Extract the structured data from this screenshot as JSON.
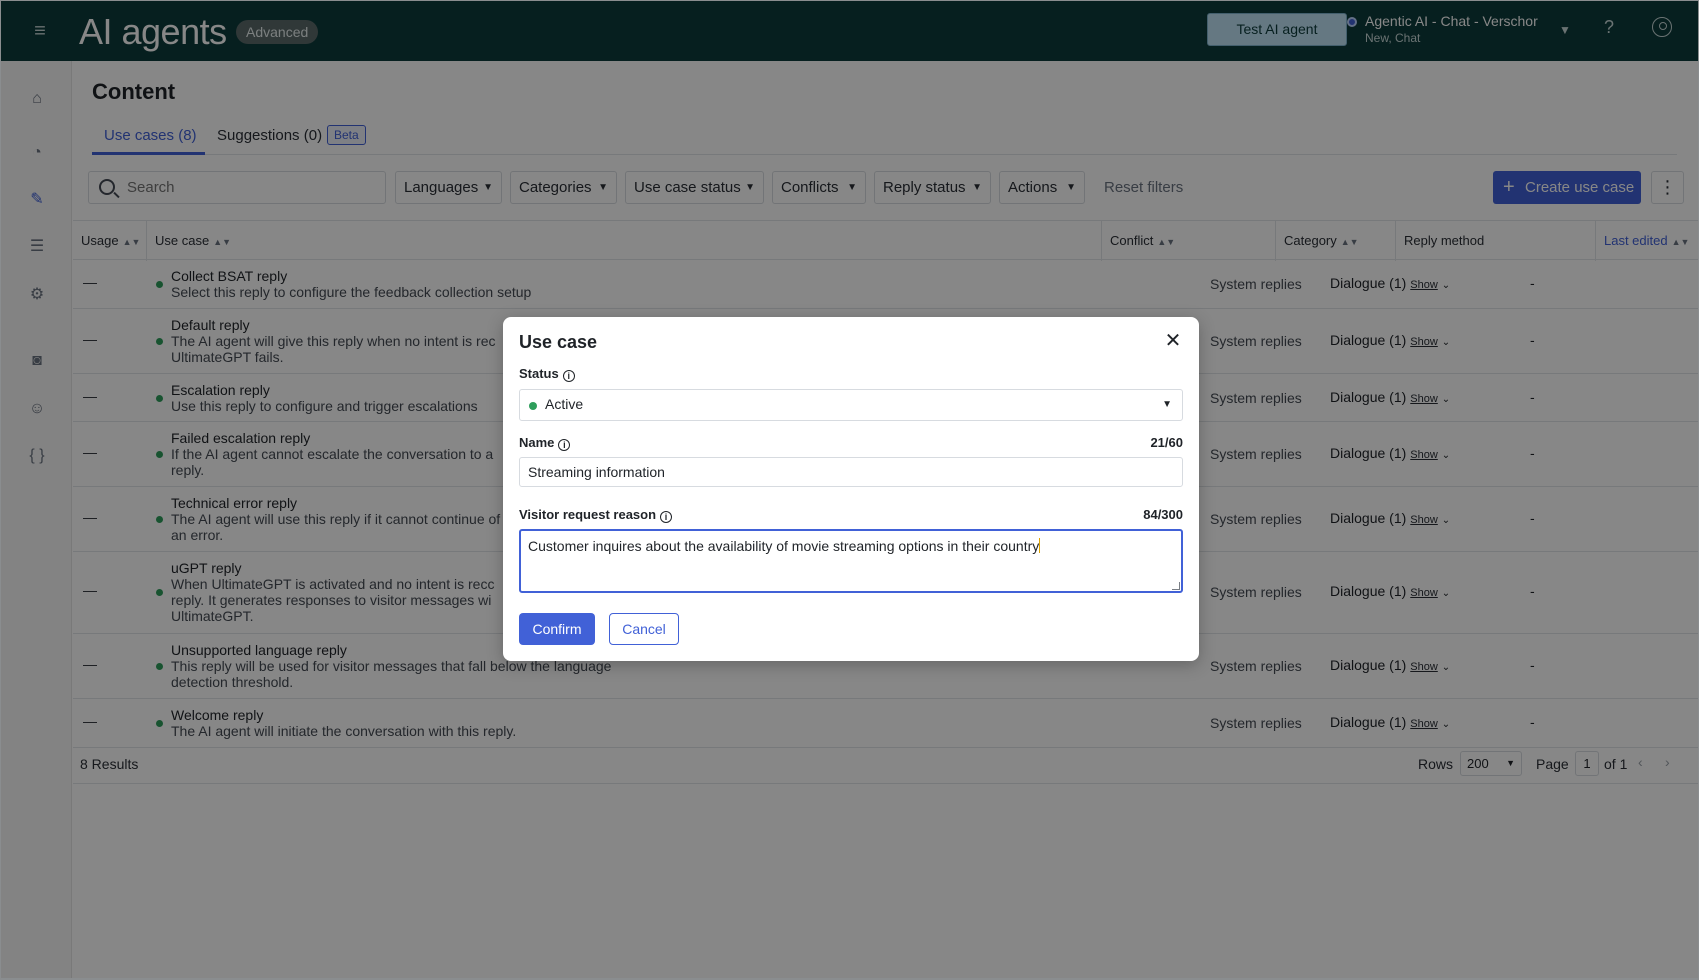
{
  "header": {
    "title": "AI agents",
    "badge": "Advanced",
    "test_button": "Test AI agent",
    "bot_name": "Agentic AI - Chat - Verschor",
    "bot_sub": "New, Chat"
  },
  "page": {
    "title": "Content",
    "tabs": [
      {
        "label": "Use cases (8)"
      },
      {
        "label": "Suggestions (0)",
        "badge": "Beta"
      }
    ]
  },
  "toolbar": {
    "search_placeholder": "Search",
    "filters": [
      "Languages",
      "Categories",
      "Use case status",
      "Conflicts",
      "Reply status",
      "Actions"
    ],
    "reset": "Reset filters",
    "create": "Create use case"
  },
  "table": {
    "headers": [
      "Usage",
      "Use case",
      "Conflict",
      "Category",
      "Reply method",
      "Last edited"
    ],
    "rows": [
      {
        "usage": "—",
        "title": "Collect BSAT reply",
        "desc": "Select this reply to configure the feedback collection setup",
        "category": "System replies",
        "reply": "Dialogue (1)",
        "show": "Show",
        "edited": "-"
      },
      {
        "usage": "—",
        "title": "Default reply",
        "desc": "The AI agent will give this reply when no intent is rec UltimateGPT fails.",
        "category": "System replies",
        "reply": "Dialogue (1)",
        "show": "Show",
        "edited": "-"
      },
      {
        "usage": "—",
        "title": "Escalation reply",
        "desc": "Use this reply to configure and trigger escalations",
        "category": "System replies",
        "reply": "Dialogue (1)",
        "show": "Show",
        "edited": "-"
      },
      {
        "usage": "—",
        "title": "Failed escalation reply",
        "desc": "If the AI agent cannot escalate the conversation to a reply.",
        "category": "System replies",
        "reply": "Dialogue (1)",
        "show": "Show",
        "edited": "-"
      },
      {
        "usage": "—",
        "title": "Technical error reply",
        "desc": "The AI agent will use this reply if it cannot continue of an error.",
        "category": "System replies",
        "reply": "Dialogue (1)",
        "show": "Show",
        "edited": "-"
      },
      {
        "usage": "—",
        "title": "uGPT reply",
        "desc": "When UltimateGPT is activated and no intent is recc reply. It generates responses to visitor messages wi UltimateGPT.",
        "category": "System replies",
        "reply": "Dialogue (1)",
        "show": "Show",
        "edited": "-"
      },
      {
        "usage": "—",
        "title": "Unsupported language reply",
        "desc": "This reply will be used for visitor messages that fall below the language detection threshold.",
        "category": "System replies",
        "reply": "Dialogue (1)",
        "show": "Show",
        "edited": "-"
      },
      {
        "usage": "—",
        "title": "Welcome reply",
        "desc": "The AI agent will initiate the conversation with this reply.",
        "category": "System replies",
        "reply": "Dialogue (1)",
        "show": "Show",
        "edited": "-"
      }
    ],
    "results": "8 Results",
    "rows_label": "Rows",
    "rows_value": "200",
    "page_label": "Page",
    "page_value": "1",
    "of_label": "of 1"
  },
  "modal": {
    "title": "Use case",
    "status_label": "Status",
    "status_value": "Active",
    "name_label": "Name",
    "name_count": "21/60",
    "name_value": "Streaming information",
    "reason_label": "Visitor request reason",
    "reason_count": "84/300",
    "reason_value": "Customer inquires about the availability of movie streaming options in their country",
    "confirm": "Confirm",
    "cancel": "Cancel"
  },
  "colors": {
    "topbar": "#0d3b3b",
    "accent": "#4161d7",
    "active_dot": "#2e9e5b"
  }
}
